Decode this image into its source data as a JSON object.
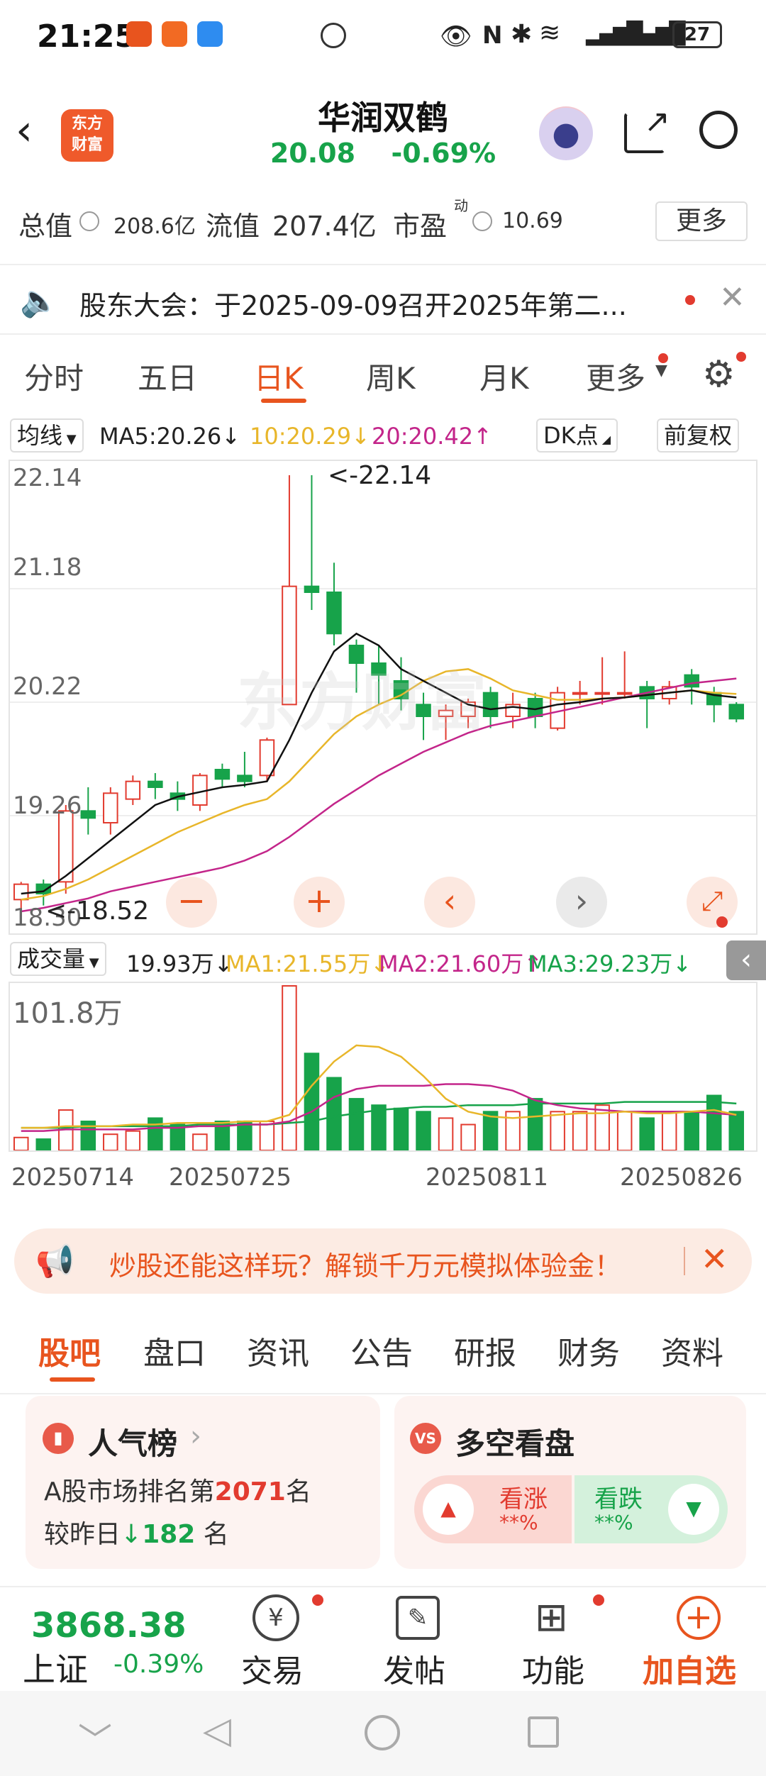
{
  "status_bar": {
    "time": "21:25",
    "battery": "27"
  },
  "header": {
    "logo_text": "东方\n财富",
    "stock_name": "华润双鹤",
    "price": "20.08",
    "change": "-0.69%"
  },
  "stats": {
    "total_value_label": "总值",
    "total_value": "208.6亿",
    "float_value_label": "流值",
    "float_value": "207.4亿",
    "pe_label": "市盈",
    "pe_sup": "动",
    "pe_value": "10.69",
    "more": "更多"
  },
  "notice": {
    "text": "股东大会：于2025-09-09召开2025年第二..."
  },
  "tabs": [
    "分时",
    "五日",
    "日K",
    "周K",
    "月K",
    "更多"
  ],
  "ma_row": {
    "type_label": "均线",
    "ma5": "MA5:20.26↓",
    "ma10": "10:20.29↓",
    "ma20": "20:20.42↑",
    "dk": "DK点",
    "fq": "前复权"
  },
  "price_chart": {
    "y_ticks": [
      "22.14",
      "21.18",
      "20.22",
      "19.26",
      "18.30"
    ],
    "high_label": "<-22.14",
    "low_label": "<-18.52"
  },
  "vol_row": {
    "label": "成交量",
    "value": "19.93万↓",
    "ma1": "MA1:21.55万↓",
    "ma2": "MA2:21.60万↑",
    "ma3": "MA3:29.23万↓"
  },
  "vol_chart": {
    "max_label": "101.8万"
  },
  "dates": [
    "20250714",
    "20250725",
    "20250811",
    "20250826"
  ],
  "promo": {
    "text": "炒股还能这样玩？解锁千万元模拟体验金！"
  },
  "sub_tabs": [
    "股吧",
    "盘口",
    "资讯",
    "公告",
    "研报",
    "财务",
    "资料"
  ],
  "popularity": {
    "title": "人气榜",
    "rank_prefix": "A股市场排名第",
    "rank": "2071",
    "rank_suffix": "名",
    "change_prefix": "较昨日",
    "change": "182",
    "change_suffix": "名"
  },
  "sentiment": {
    "title": "多空看盘",
    "up_label": "看涨",
    "up_value": "**%",
    "down_label": "看跌",
    "down_value": "**%"
  },
  "bottom": {
    "index_value": "3868.38",
    "index_name": "上证",
    "index_change": "-0.39%",
    "trade": "交易",
    "post": "发帖",
    "func": "功能",
    "add": "加自选"
  },
  "colors": {
    "up": "#e23b2f",
    "down": "#17a34a",
    "accent": "#e8541e",
    "ma10": "#e8b62a",
    "ma20": "#c3258a"
  },
  "chart_data": {
    "type": "candlestick",
    "categories": [
      "20250714",
      "20250715",
      "20250716",
      "20250717",
      "20250718",
      "20250721",
      "20250722",
      "20250723",
      "20250724",
      "20250725",
      "20250728",
      "20250729",
      "20250730",
      "20250731",
      "20250801",
      "20250804",
      "20250805",
      "20250806",
      "20250807",
      "20250808",
      "20250811",
      "20250812",
      "20250813",
      "20250814",
      "20250815",
      "20250818",
      "20250819",
      "20250820",
      "20250821",
      "20250822",
      "20250825",
      "20250826",
      "20250827"
    ],
    "candles": [
      {
        "o": 18.55,
        "c": 18.68,
        "h": 18.7,
        "l": 18.4
      },
      {
        "o": 18.68,
        "c": 18.6,
        "h": 18.72,
        "l": 18.5
      },
      {
        "o": 18.7,
        "c": 19.3,
        "h": 19.35,
        "l": 18.6
      },
      {
        "o": 19.3,
        "c": 19.24,
        "h": 19.5,
        "l": 19.1
      },
      {
        "o": 19.2,
        "c": 19.45,
        "h": 19.5,
        "l": 19.1
      },
      {
        "o": 19.4,
        "c": 19.55,
        "h": 19.6,
        "l": 19.35
      },
      {
        "o": 19.55,
        "c": 19.5,
        "h": 19.62,
        "l": 19.4
      },
      {
        "o": 19.45,
        "c": 19.4,
        "h": 19.55,
        "l": 19.3
      },
      {
        "o": 19.35,
        "c": 19.6,
        "h": 19.62,
        "l": 19.3
      },
      {
        "o": 19.65,
        "c": 19.57,
        "h": 19.7,
        "l": 19.5
      },
      {
        "o": 19.6,
        "c": 19.55,
        "h": 19.8,
        "l": 19.5
      },
      {
        "o": 19.6,
        "c": 19.9,
        "h": 19.92,
        "l": 19.55
      },
      {
        "o": 20.2,
        "c": 21.2,
        "h": 22.14,
        "l": 20.2
      },
      {
        "o": 21.2,
        "c": 21.15,
        "h": 22.14,
        "l": 21.0
      },
      {
        "o": 21.15,
        "c": 20.8,
        "h": 21.4,
        "l": 20.7
      },
      {
        "o": 20.7,
        "c": 20.55,
        "h": 20.75,
        "l": 20.3
      },
      {
        "o": 20.55,
        "c": 20.45,
        "h": 20.7,
        "l": 20.2
      },
      {
        "o": 20.4,
        "c": 20.25,
        "h": 20.6,
        "l": 20.15
      },
      {
        "o": 20.2,
        "c": 20.1,
        "h": 20.3,
        "l": 19.9
      },
      {
        "o": 20.1,
        "c": 20.15,
        "h": 20.2,
        "l": 19.9
      },
      {
        "o": 20.1,
        "c": 20.22,
        "h": 20.25,
        "l": 20.0
      },
      {
        "o": 20.3,
        "c": 20.1,
        "h": 20.35,
        "l": 20.0
      },
      {
        "o": 20.1,
        "c": 20.2,
        "h": 20.3,
        "l": 20.0
      },
      {
        "o": 20.25,
        "c": 20.1,
        "h": 20.3,
        "l": 20.0
      },
      {
        "o": 20.0,
        "c": 20.3,
        "h": 20.35,
        "l": 19.98
      },
      {
        "o": 20.3,
        "c": 20.3,
        "h": 20.4,
        "l": 20.2
      },
      {
        "o": 20.3,
        "c": 20.3,
        "h": 20.6,
        "l": 20.2
      },
      {
        "o": 20.3,
        "c": 20.3,
        "h": 20.65,
        "l": 20.25
      },
      {
        "o": 20.35,
        "c": 20.25,
        "h": 20.4,
        "l": 20.0
      },
      {
        "o": 20.25,
        "c": 20.35,
        "h": 20.4,
        "l": 20.2
      },
      {
        "o": 20.45,
        "c": 20.35,
        "h": 20.5,
        "l": 20.2
      },
      {
        "o": 20.3,
        "c": 20.2,
        "h": 20.35,
        "l": 20.05
      },
      {
        "o": 20.2,
        "c": 20.08,
        "h": 20.22,
        "l": 20.05
      }
    ],
    "ma5": [
      18.6,
      18.62,
      18.75,
      18.9,
      19.05,
      19.2,
      19.35,
      19.42,
      19.46,
      19.5,
      19.52,
      19.55,
      19.9,
      20.3,
      20.65,
      20.8,
      20.7,
      20.5,
      20.4,
      20.3,
      20.2,
      20.16,
      20.18,
      20.16,
      20.2,
      20.22,
      20.25,
      20.26,
      20.28,
      20.3,
      20.32,
      20.28,
      20.26
    ],
    "ma10": [
      18.55,
      18.58,
      18.64,
      18.72,
      18.82,
      18.92,
      19.02,
      19.12,
      19.2,
      19.28,
      19.35,
      19.4,
      19.55,
      19.75,
      19.95,
      20.1,
      20.2,
      20.28,
      20.4,
      20.48,
      20.5,
      20.42,
      20.32,
      20.28,
      20.24,
      20.24,
      20.25,
      20.26,
      20.28,
      20.3,
      20.32,
      20.3,
      20.29
    ],
    "ma20": [
      18.45,
      18.48,
      18.52,
      18.56,
      18.62,
      18.66,
      18.7,
      18.74,
      18.78,
      18.82,
      18.88,
      18.96,
      19.08,
      19.22,
      19.36,
      19.48,
      19.6,
      19.7,
      19.8,
      19.88,
      19.96,
      20.02,
      20.06,
      20.1,
      20.14,
      20.18,
      20.22,
      20.26,
      20.3,
      20.34,
      20.38,
      20.4,
      20.42
    ],
    "volume": [
      8,
      7,
      25,
      18,
      10,
      12,
      20,
      16,
      10,
      18,
      18,
      18,
      101.8,
      60,
      45,
      32,
      28,
      26,
      24,
      20,
      16,
      24,
      24,
      32,
      24,
      24,
      28,
      24,
      20,
      24,
      24,
      34,
      24
    ],
    "vol_ma1": [
      14,
      14,
      15,
      15,
      15,
      16,
      16,
      17,
      17,
      17,
      18,
      18,
      22,
      40,
      55,
      65,
      64,
      58,
      46,
      32,
      24,
      21,
      20,
      21,
      22,
      23,
      23,
      24,
      23,
      23,
      24,
      25,
      22
    ],
    "vol_ma2": [
      12,
      12,
      13,
      13,
      13,
      13,
      14,
      14,
      15,
      15,
      16,
      16,
      18,
      24,
      33,
      38,
      40,
      40,
      40,
      41,
      41,
      40,
      37,
      31,
      28,
      26,
      25,
      24,
      24,
      24,
      24,
      23,
      22
    ],
    "vol_ma3": [
      14,
      14,
      14,
      15,
      15,
      15,
      15,
      15,
      16,
      16,
      16,
      16,
      17,
      18,
      21,
      23,
      25,
      26,
      27,
      27,
      28,
      28,
      28,
      29,
      29,
      29,
      29,
      30,
      30,
      30,
      30,
      30,
      29
    ],
    "ylim": [
      18.3,
      22.14
    ]
  }
}
